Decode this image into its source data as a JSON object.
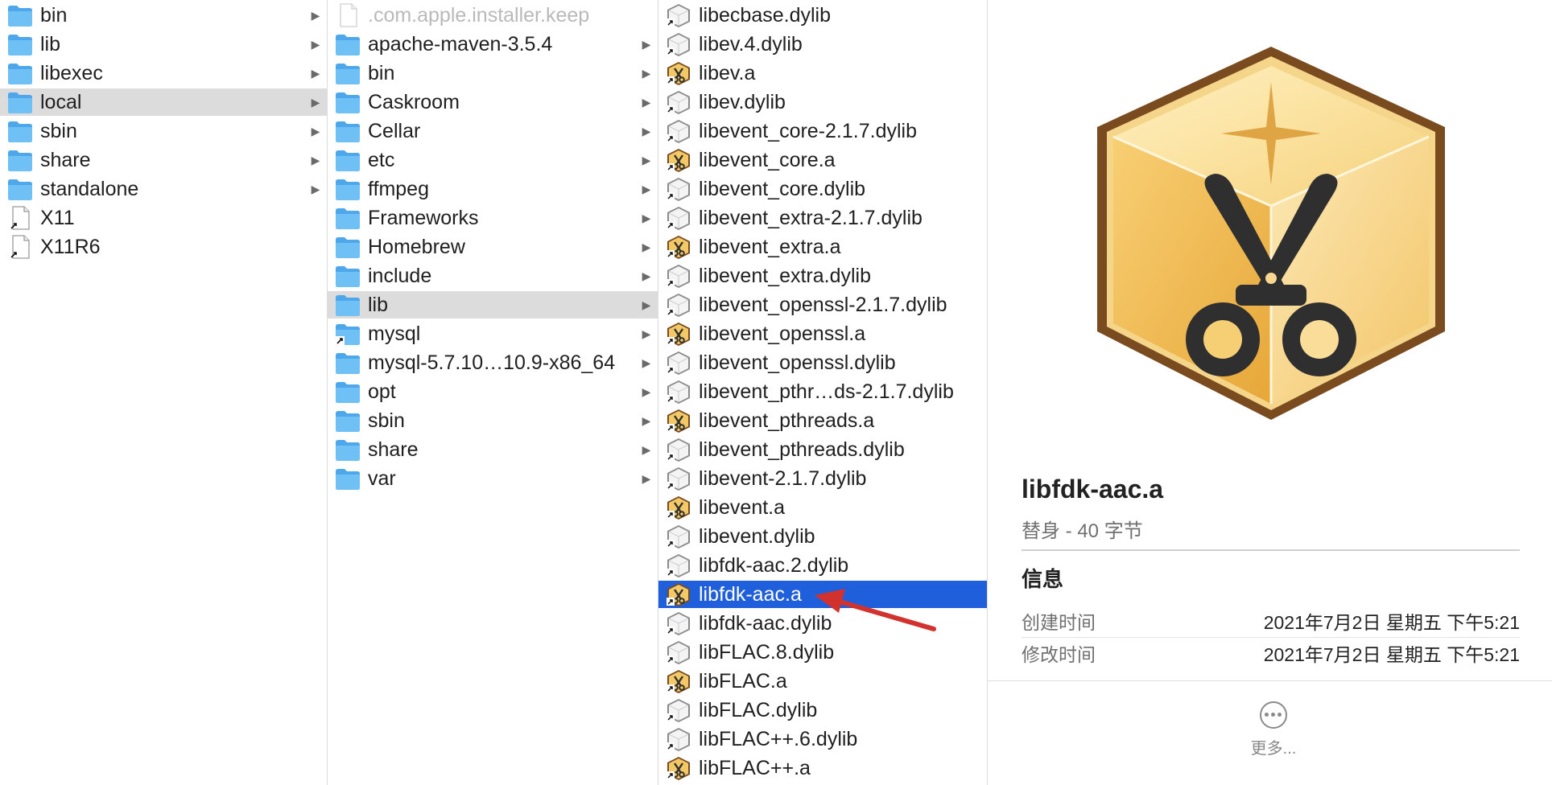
{
  "columns": {
    "col1": [
      {
        "label": "bin",
        "type": "folder",
        "arrow": true,
        "state": ""
      },
      {
        "label": "lib",
        "type": "folder",
        "arrow": true,
        "state": ""
      },
      {
        "label": "libexec",
        "type": "folder",
        "arrow": true,
        "state": ""
      },
      {
        "label": "local",
        "type": "folder",
        "arrow": true,
        "state": "sel-gray"
      },
      {
        "label": "sbin",
        "type": "folder",
        "arrow": true,
        "state": ""
      },
      {
        "label": "share",
        "type": "folder",
        "arrow": true,
        "state": ""
      },
      {
        "label": "standalone",
        "type": "folder",
        "arrow": true,
        "state": ""
      },
      {
        "label": "X11",
        "type": "alias",
        "arrow": false,
        "state": ""
      },
      {
        "label": "X11R6",
        "type": "alias",
        "arrow": false,
        "state": ""
      }
    ],
    "col2": [
      {
        "label": ".com.apple.installer.keep",
        "type": "file",
        "arrow": false,
        "state": "dim"
      },
      {
        "label": "apache-maven-3.5.4",
        "type": "folder",
        "arrow": true,
        "state": ""
      },
      {
        "label": "bin",
        "type": "folder",
        "arrow": true,
        "state": ""
      },
      {
        "label": "Caskroom",
        "type": "folder",
        "arrow": true,
        "state": ""
      },
      {
        "label": "Cellar",
        "type": "folder",
        "arrow": true,
        "state": ""
      },
      {
        "label": "etc",
        "type": "folder",
        "arrow": true,
        "state": ""
      },
      {
        "label": "ffmpeg",
        "type": "folder",
        "arrow": true,
        "state": ""
      },
      {
        "label": "Frameworks",
        "type": "folder",
        "arrow": true,
        "state": ""
      },
      {
        "label": "Homebrew",
        "type": "folder",
        "arrow": true,
        "state": ""
      },
      {
        "label": "include",
        "type": "folder",
        "arrow": true,
        "state": ""
      },
      {
        "label": "lib",
        "type": "folder",
        "arrow": true,
        "state": "sel-gray"
      },
      {
        "label": "mysql",
        "type": "folder-alias",
        "arrow": true,
        "state": ""
      },
      {
        "label": "mysql-5.7.10…10.9-x86_64",
        "type": "folder",
        "arrow": true,
        "state": ""
      },
      {
        "label": "opt",
        "type": "folder",
        "arrow": true,
        "state": ""
      },
      {
        "label": "sbin",
        "type": "folder",
        "arrow": true,
        "state": ""
      },
      {
        "label": "share",
        "type": "folder",
        "arrow": true,
        "state": ""
      },
      {
        "label": "var",
        "type": "folder",
        "arrow": true,
        "state": ""
      }
    ],
    "col3": [
      {
        "label": "libecbase.dylib",
        "type": "dylib",
        "arrow": false,
        "state": ""
      },
      {
        "label": "libev.4.dylib",
        "type": "dylib",
        "arrow": false,
        "state": ""
      },
      {
        "label": "libev.a",
        "type": "lib",
        "arrow": false,
        "state": ""
      },
      {
        "label": "libev.dylib",
        "type": "dylib",
        "arrow": false,
        "state": ""
      },
      {
        "label": "libevent_core-2.1.7.dylib",
        "type": "dylib",
        "arrow": false,
        "state": ""
      },
      {
        "label": "libevent_core.a",
        "type": "lib",
        "arrow": false,
        "state": ""
      },
      {
        "label": "libevent_core.dylib",
        "type": "dylib",
        "arrow": false,
        "state": ""
      },
      {
        "label": "libevent_extra-2.1.7.dylib",
        "type": "dylib",
        "arrow": false,
        "state": ""
      },
      {
        "label": "libevent_extra.a",
        "type": "lib",
        "arrow": false,
        "state": ""
      },
      {
        "label": "libevent_extra.dylib",
        "type": "dylib",
        "arrow": false,
        "state": ""
      },
      {
        "label": "libevent_openssl-2.1.7.dylib",
        "type": "dylib",
        "arrow": false,
        "state": ""
      },
      {
        "label": "libevent_openssl.a",
        "type": "lib",
        "arrow": false,
        "state": ""
      },
      {
        "label": "libevent_openssl.dylib",
        "type": "dylib",
        "arrow": false,
        "state": ""
      },
      {
        "label": "libevent_pthr…ds-2.1.7.dylib",
        "type": "dylib",
        "arrow": false,
        "state": ""
      },
      {
        "label": "libevent_pthreads.a",
        "type": "lib",
        "arrow": false,
        "state": ""
      },
      {
        "label": "libevent_pthreads.dylib",
        "type": "dylib",
        "arrow": false,
        "state": ""
      },
      {
        "label": "libevent-2.1.7.dylib",
        "type": "dylib",
        "arrow": false,
        "state": ""
      },
      {
        "label": "libevent.a",
        "type": "lib",
        "arrow": false,
        "state": ""
      },
      {
        "label": "libevent.dylib",
        "type": "dylib",
        "arrow": false,
        "state": ""
      },
      {
        "label": "libfdk-aac.2.dylib",
        "type": "dylib",
        "arrow": false,
        "state": ""
      },
      {
        "label": "libfdk-aac.a",
        "type": "lib",
        "arrow": false,
        "state": "sel-blue"
      },
      {
        "label": "libfdk-aac.dylib",
        "type": "dylib",
        "arrow": false,
        "state": ""
      },
      {
        "label": "libFLAC.8.dylib",
        "type": "dylib",
        "arrow": false,
        "state": ""
      },
      {
        "label": "libFLAC.a",
        "type": "lib",
        "arrow": false,
        "state": ""
      },
      {
        "label": "libFLAC.dylib",
        "type": "dylib",
        "arrow": false,
        "state": ""
      },
      {
        "label": "libFLAC++.6.dylib",
        "type": "dylib",
        "arrow": false,
        "state": ""
      },
      {
        "label": "libFLAC++.a",
        "type": "lib",
        "arrow": false,
        "state": ""
      }
    ]
  },
  "preview": {
    "icon": "library-archive-icon",
    "name": "libfdk-aac.a",
    "kind": "替身 - 40 字节",
    "info_heading": "信息",
    "created_label": "创建时间",
    "created_value": "2021年7月2日 星期五 下午5:21",
    "modified_label": "修改时间",
    "modified_value": "2021年7月2日 星期五 下午5:21",
    "more_label": "更多..."
  },
  "colors": {
    "selection_blue": "#1f5fdb",
    "selection_gray": "#dcdcdc",
    "folder_blue": "#5db4f0",
    "annotation_red": "#d2322d"
  }
}
